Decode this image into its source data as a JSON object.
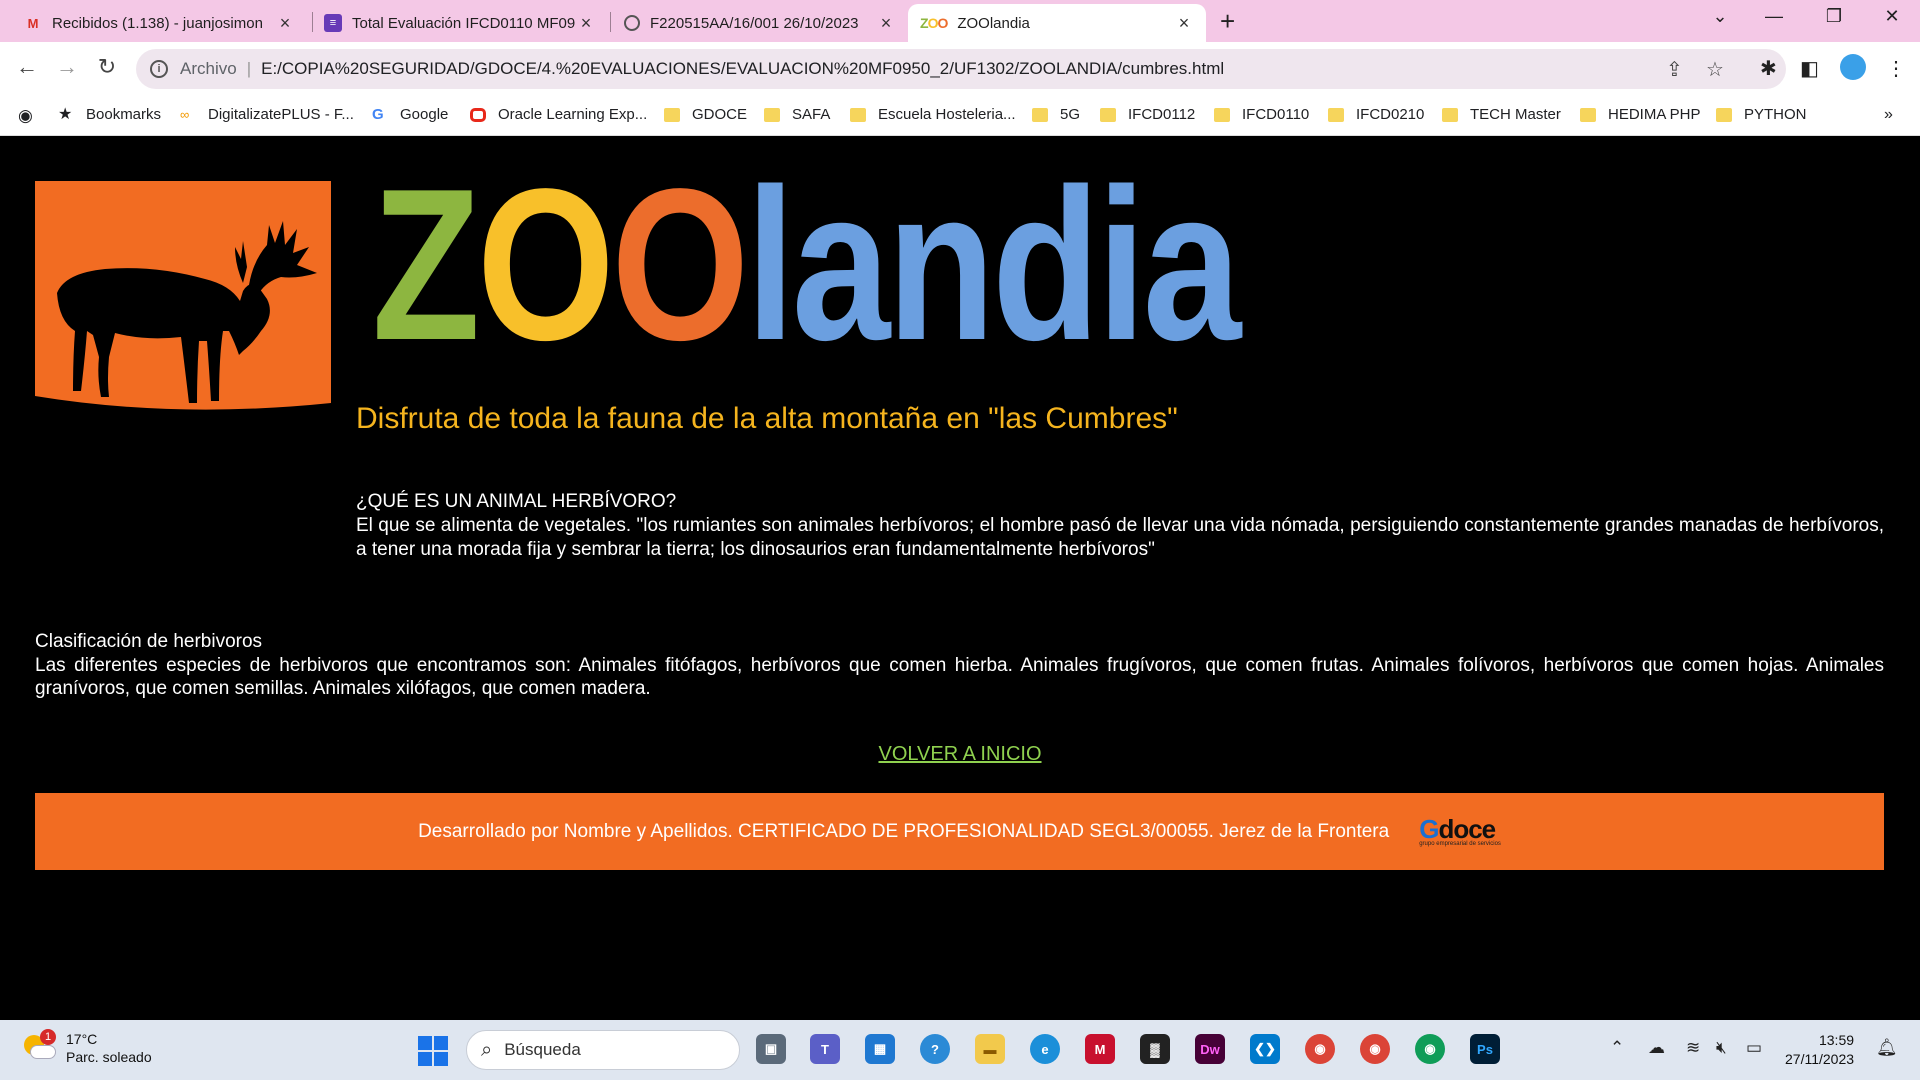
{
  "tabs": [
    {
      "title": "Recibidos (1.138) - juanjosimon",
      "icon": "gmail-icon"
    },
    {
      "title": "Total Evaluación IFCD0110 MF09",
      "icon": "forms-icon"
    },
    {
      "title": "F220515AA/16/001 26/10/2023",
      "icon": "globe-icon"
    },
    {
      "title": "ZOOlandia",
      "icon": "zoo-favicon",
      "favicon_text": "ZOO"
    }
  ],
  "address": {
    "label": "Archivo",
    "url": "E:/COPIA%20SEGURIDAD/GDOCE/4.%20EVALUACIONES/EVALUACION%20MF0950_2/UF1302/ZOOLANDIA/cumbres.html"
  },
  "bookmarks": [
    "Bookmarks",
    "DigitalizatePLUS - F...",
    "Google",
    "Oracle Learning Exp...",
    "GDOCE",
    "SAFA",
    "Escuela Hosteleria...",
    "5G",
    "IFCD0112",
    "IFCD0110",
    "IFCD0210",
    "TECH Master",
    "HEDIMA PHP",
    "PYTHON"
  ],
  "colors": {
    "z": "#8db640",
    "o1": "#f8c02a",
    "o2": "#ec6d2c",
    "landia": "#6b9fe0",
    "orange": "#f26c22",
    "tagline": "#f5b41e",
    "link": "#8fd14f"
  },
  "brand": {
    "z": "Z",
    "o1": "O",
    "o2": "O",
    "rest": "landia"
  },
  "content": {
    "tagline": "Disfruta de toda la fauna de la alta montaña en \"las Cumbres\"",
    "question_title": "¿QUÉ ES UN ANIMAL HERBÍVORO?",
    "question_text": "El que se alimenta de vegetales. \"los rumiantes son animales herbívoros; el hombre pasó de llevar una vida nómada, persiguiendo constantemente grandes manadas de herbívoros, a tener una morada fija y sembrar la tierra; los dinosaurios eran fundamentalmente herbívoros\"",
    "class_title": "Clasificación de herbivoros",
    "class_text": "Las diferentes especies de herbivoros que encontramos son: Animales fitófagos, herbívoros que comen hierba. Animales frugívoros, que comen frutas. Animales folívoros, herbívoros que comen hojas. Animales granívoros, que comen semillas. Animales xilófagos, que comen madera.",
    "back_link": "VOLVER A INICIO",
    "footer": "Desarrollado por Nombre y Apellidos. CERTIFICADO DE PROFESIONALIDAD SEGL3/00055. Jerez de la Frontera",
    "footer_logo": "doce",
    "footer_logo_sub": "grupo empresarial de servicios"
  },
  "taskbar": {
    "weather_temp": "17°C",
    "weather_desc": "Parc. soleado",
    "weather_badge": "1",
    "search_placeholder": "Búsqueda",
    "time": "13:59",
    "date": "27/11/2023"
  }
}
